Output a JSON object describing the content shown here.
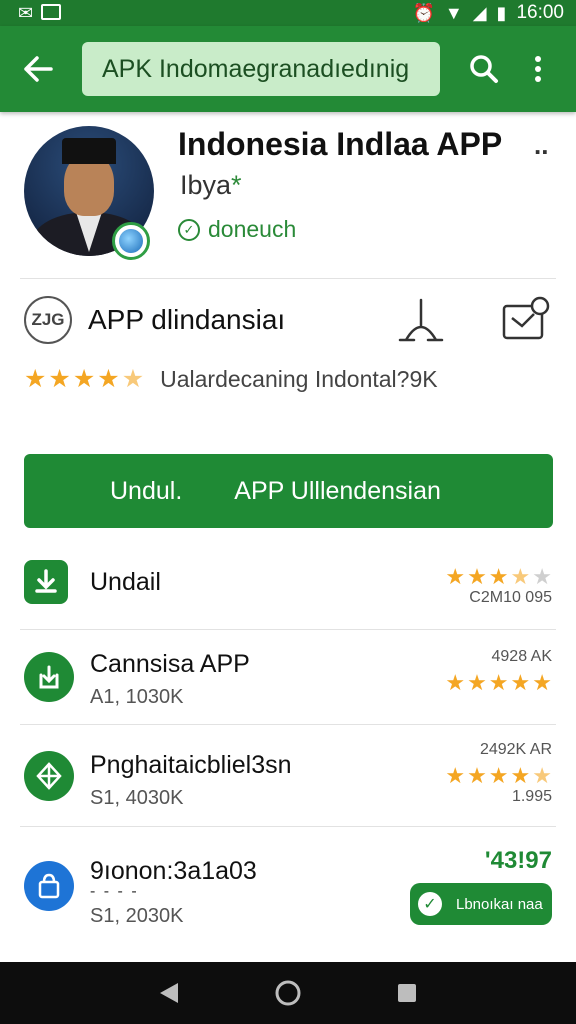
{
  "status_bar": {
    "time": "16:00",
    "left_icons": [
      "mail-icon",
      "gmail-icon"
    ],
    "right_icons": [
      "alarm-icon",
      "wifi-icon",
      "signal-icon",
      "battery-icon"
    ]
  },
  "app_bar": {
    "back_icon": "arrow-left-icon",
    "search_text": "APK Indomaegranadıedınig",
    "search_icon": "search-icon",
    "more_icon": "more-vert-icon",
    "color": "#238a36"
  },
  "app": {
    "title": "Indonesia Indlaa APP",
    "title_more": "..",
    "developer": "Ibya",
    "developer_mark": "*",
    "verified_text": "doneuch"
  },
  "info": {
    "icon_text": "ZJG",
    "label": "APP dlindansiaı",
    "share_icon": "share-icon",
    "wishlist_icon": "wishlist-icon"
  },
  "rating": {
    "stars": 4.5,
    "text": "Ualardecaning Indontal?9K"
  },
  "install": {
    "label_left": "Undul.",
    "label_right": "APP Ulllendensian"
  },
  "list": [
    {
      "title": "Undail",
      "sub": "",
      "meta_top": "",
      "stars": 3.5,
      "meta_bottom": "C2M10 095",
      "icon": "download-icon"
    },
    {
      "title": "Cannsisa APP",
      "sub": "A1, 1030K",
      "meta_top": "4928 AK",
      "stars": 5,
      "meta_bottom": "",
      "icon": "install-box-icon"
    },
    {
      "title": "Pnghaitaicbliel3sn",
      "sub": "S1, 4030K",
      "meta_top": "2492K AR",
      "stars": 4.5,
      "meta_bottom": "1.995",
      "icon": "diamond-icon"
    },
    {
      "title": "9ıonon:3a1a03",
      "dots": "- - - -",
      "sub": "S1, 2030K",
      "price": "'43!97",
      "button_label": "Lbnoıkaı naa",
      "icon": "shopping-bag-icon"
    }
  ],
  "nav": {
    "back_icon": "nav-back-icon",
    "home_icon": "nav-home-icon",
    "recents_icon": "nav-recents-icon"
  },
  "colors": {
    "primary": "#1f8a35",
    "star": "#f4a623",
    "blue": "#1e74d6"
  }
}
